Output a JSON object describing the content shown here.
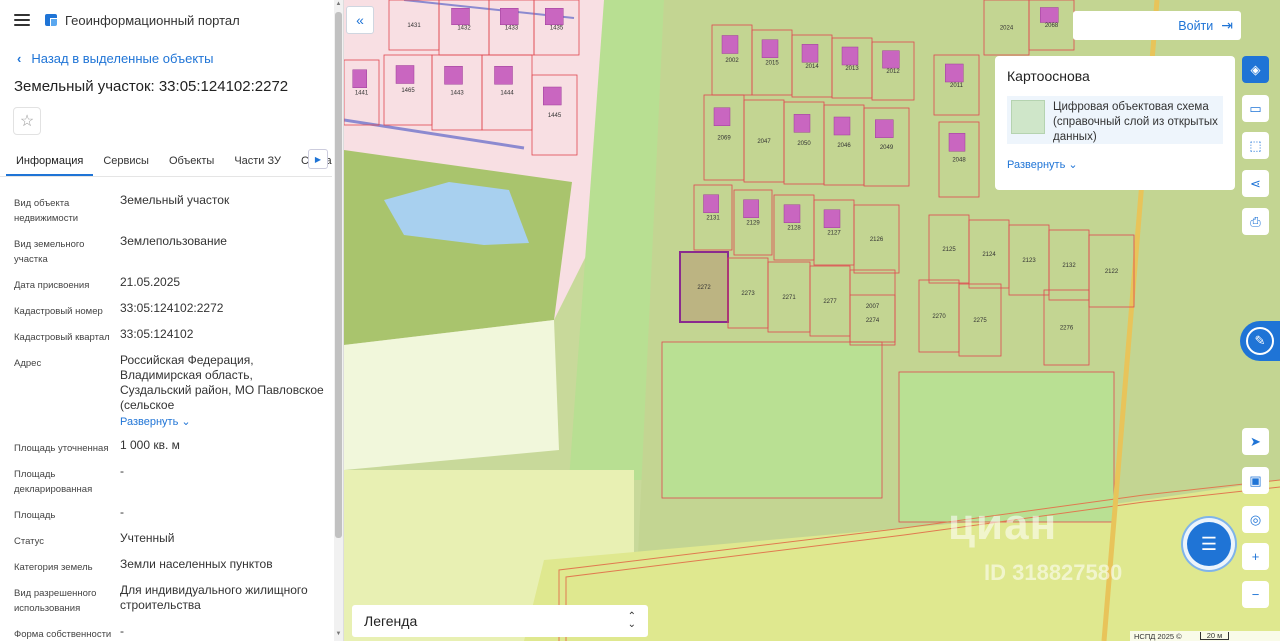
{
  "header": {
    "portal_title": "Геоинформационный портал"
  },
  "nav": {
    "back_label": "Назад в выделенные объекты"
  },
  "object": {
    "title": "Земельный участок: 33:05:124102:2272"
  },
  "tabs": [
    {
      "label": "Информация",
      "active": true
    },
    {
      "label": "Сервисы"
    },
    {
      "label": "Объекты"
    },
    {
      "label": "Части ЗУ"
    },
    {
      "label": "Состав"
    }
  ],
  "properties": [
    {
      "label": "Вид объекта недвижимости",
      "value": "Земельный участок"
    },
    {
      "label": "Вид земельного участка",
      "value": "Землепользование"
    },
    {
      "label": "Дата присвоения",
      "value": "21.05.2025"
    },
    {
      "label": "Кадастровый номер",
      "value": "33:05:124102:2272"
    },
    {
      "label": "Кадастровый квартал",
      "value": "33:05:124102"
    },
    {
      "label": "Адрес",
      "value": "Российская Федерация, Владимирская область, Суздальский район, МО Павловское (сельское",
      "expand": "Развернуть"
    },
    {
      "label": "Площадь уточненная",
      "value": "1 000 кв. м"
    },
    {
      "label": "Площадь декларированная",
      "value": "-"
    },
    {
      "label": "Площадь",
      "value": "-"
    },
    {
      "label": "Статус",
      "value": "Учтенный"
    },
    {
      "label": "Категория земель",
      "value": "Земли населенных пунктов"
    },
    {
      "label": "Вид разрешенного использования",
      "value": "Для индивидуального жилищного строительства"
    },
    {
      "label": "Форма собственности",
      "value": "-"
    }
  ],
  "map": {
    "login_label": "Войти",
    "basemap": {
      "title": "Картооснова",
      "layer": "Цифровая объектовая схема (справочный слой из открытых данных)",
      "expand": "Развернуть"
    },
    "legend_label": "Легенда",
    "credits": "НСПД 2025 ©",
    "scale": "20 м",
    "watermark": "циан",
    "watermark_id": "ID 318827580",
    "plots": [
      {
        "label": "1431"
      },
      {
        "label": "1432"
      },
      {
        "label": "1433"
      },
      {
        "label": "1435"
      },
      {
        "label": "1441"
      },
      {
        "label": "1465"
      },
      {
        "label": "1443"
      },
      {
        "label": "1444"
      },
      {
        "label": "1445"
      },
      {
        "label": "2002"
      },
      {
        "label": "2015"
      },
      {
        "label": "2014"
      },
      {
        "label": "2013"
      },
      {
        "label": "2012"
      },
      {
        "label": "2011"
      },
      {
        "label": "2024"
      },
      {
        "label": "2068"
      },
      {
        "label": "2069"
      },
      {
        "label": "2047"
      },
      {
        "label": "2050"
      },
      {
        "label": "2046"
      },
      {
        "label": "2049"
      },
      {
        "label": "2048"
      },
      {
        "label": "2131"
      },
      {
        "label": "2129"
      },
      {
        "label": "2128"
      },
      {
        "label": "2127"
      },
      {
        "label": "2126"
      },
      {
        "label": "2125"
      },
      {
        "label": "2124"
      },
      {
        "label": "2123"
      },
      {
        "label": "2132"
      },
      {
        "label": "2122"
      },
      {
        "label": "2272"
      },
      {
        "label": "2273"
      },
      {
        "label": "2271"
      },
      {
        "label": "2277"
      },
      {
        "label": "2007"
      },
      {
        "label": "2274"
      },
      {
        "label": "2270"
      },
      {
        "label": "2275"
      },
      {
        "label": "2276"
      }
    ]
  },
  "colors": {
    "accent": "#1f74d6",
    "plot_border": "#e0484f",
    "selected_plot": "#8a2a8f",
    "building": "#c966c0"
  }
}
